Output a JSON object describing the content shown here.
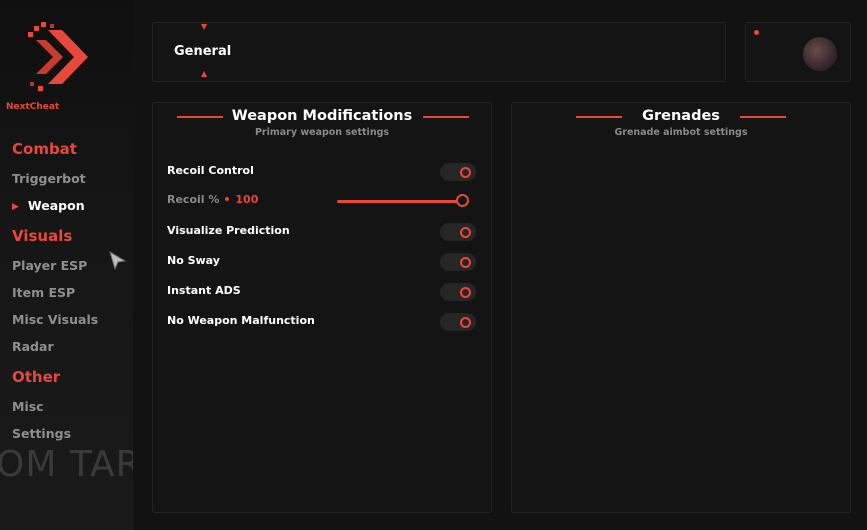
{
  "brand": {
    "name": "NextCheat",
    "background_text": "OM TAR"
  },
  "colors": {
    "accent": "#e8483b",
    "panel": "#141414",
    "muted": "#8a8a8a"
  },
  "sidebar": {
    "categories": [
      {
        "label": "Combat",
        "items": [
          "Triggerbot",
          "Weapon"
        ]
      },
      {
        "label": "Visuals",
        "items": [
          "Player ESP",
          "Item ESP",
          "Misc Visuals",
          "Radar"
        ]
      },
      {
        "label": "Other",
        "items": [
          "Misc",
          "Settings"
        ]
      }
    ],
    "active_item": "Weapon"
  },
  "tabs": {
    "current": "General"
  },
  "weapon_panel": {
    "title": "Weapon Modifications",
    "subtitle": "Primary weapon settings",
    "options": [
      {
        "label": "Recoil Control",
        "enabled": true
      },
      {
        "label": "Visualize Prediction",
        "enabled": true
      },
      {
        "label": "No Sway",
        "enabled": true
      },
      {
        "label": "Instant ADS",
        "enabled": true
      },
      {
        "label": "No Weapon Malfunction",
        "enabled": true
      }
    ],
    "recoil": {
      "label": "Recoil %",
      "value": "100",
      "fraction": 1.0
    }
  },
  "grenade_panel": {
    "title": "Grenades",
    "subtitle": "Grenade aimbot settings"
  },
  "icons": {
    "logo": "chevron-logo-icon",
    "avatar": "user-avatar-icon",
    "cursor": "mouse-pointer-icon"
  }
}
